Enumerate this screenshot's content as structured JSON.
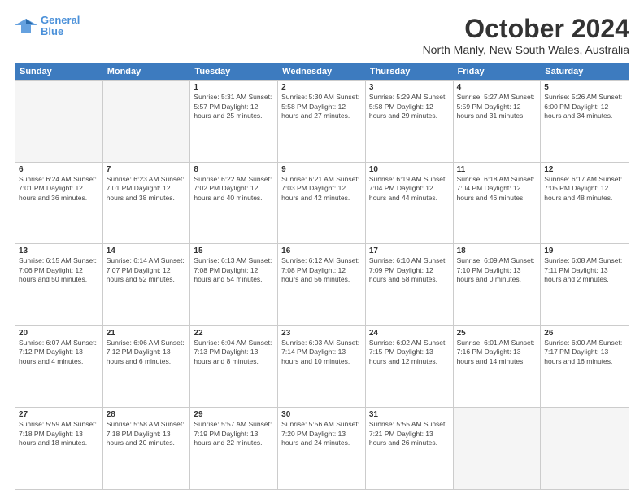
{
  "logo": {
    "line1": "General",
    "line2": "Blue"
  },
  "title": "October 2024",
  "subtitle": "North Manly, New South Wales, Australia",
  "days": [
    "Sunday",
    "Monday",
    "Tuesday",
    "Wednesday",
    "Thursday",
    "Friday",
    "Saturday"
  ],
  "weeks": [
    [
      {
        "num": "",
        "info": "",
        "empty": true
      },
      {
        "num": "",
        "info": "",
        "empty": true
      },
      {
        "num": "1",
        "info": "Sunrise: 5:31 AM\nSunset: 5:57 PM\nDaylight: 12 hours\nand 25 minutes."
      },
      {
        "num": "2",
        "info": "Sunrise: 5:30 AM\nSunset: 5:58 PM\nDaylight: 12 hours\nand 27 minutes."
      },
      {
        "num": "3",
        "info": "Sunrise: 5:29 AM\nSunset: 5:58 PM\nDaylight: 12 hours\nand 29 minutes."
      },
      {
        "num": "4",
        "info": "Sunrise: 5:27 AM\nSunset: 5:59 PM\nDaylight: 12 hours\nand 31 minutes."
      },
      {
        "num": "5",
        "info": "Sunrise: 5:26 AM\nSunset: 6:00 PM\nDaylight: 12 hours\nand 34 minutes."
      }
    ],
    [
      {
        "num": "6",
        "info": "Sunrise: 6:24 AM\nSunset: 7:01 PM\nDaylight: 12 hours\nand 36 minutes."
      },
      {
        "num": "7",
        "info": "Sunrise: 6:23 AM\nSunset: 7:01 PM\nDaylight: 12 hours\nand 38 minutes."
      },
      {
        "num": "8",
        "info": "Sunrise: 6:22 AM\nSunset: 7:02 PM\nDaylight: 12 hours\nand 40 minutes."
      },
      {
        "num": "9",
        "info": "Sunrise: 6:21 AM\nSunset: 7:03 PM\nDaylight: 12 hours\nand 42 minutes."
      },
      {
        "num": "10",
        "info": "Sunrise: 6:19 AM\nSunset: 7:04 PM\nDaylight: 12 hours\nand 44 minutes."
      },
      {
        "num": "11",
        "info": "Sunrise: 6:18 AM\nSunset: 7:04 PM\nDaylight: 12 hours\nand 46 minutes."
      },
      {
        "num": "12",
        "info": "Sunrise: 6:17 AM\nSunset: 7:05 PM\nDaylight: 12 hours\nand 48 minutes."
      }
    ],
    [
      {
        "num": "13",
        "info": "Sunrise: 6:15 AM\nSunset: 7:06 PM\nDaylight: 12 hours\nand 50 minutes."
      },
      {
        "num": "14",
        "info": "Sunrise: 6:14 AM\nSunset: 7:07 PM\nDaylight: 12 hours\nand 52 minutes."
      },
      {
        "num": "15",
        "info": "Sunrise: 6:13 AM\nSunset: 7:08 PM\nDaylight: 12 hours\nand 54 minutes."
      },
      {
        "num": "16",
        "info": "Sunrise: 6:12 AM\nSunset: 7:08 PM\nDaylight: 12 hours\nand 56 minutes."
      },
      {
        "num": "17",
        "info": "Sunrise: 6:10 AM\nSunset: 7:09 PM\nDaylight: 12 hours\nand 58 minutes."
      },
      {
        "num": "18",
        "info": "Sunrise: 6:09 AM\nSunset: 7:10 PM\nDaylight: 13 hours\nand 0 minutes."
      },
      {
        "num": "19",
        "info": "Sunrise: 6:08 AM\nSunset: 7:11 PM\nDaylight: 13 hours\nand 2 minutes."
      }
    ],
    [
      {
        "num": "20",
        "info": "Sunrise: 6:07 AM\nSunset: 7:12 PM\nDaylight: 13 hours\nand 4 minutes."
      },
      {
        "num": "21",
        "info": "Sunrise: 6:06 AM\nSunset: 7:12 PM\nDaylight: 13 hours\nand 6 minutes."
      },
      {
        "num": "22",
        "info": "Sunrise: 6:04 AM\nSunset: 7:13 PM\nDaylight: 13 hours\nand 8 minutes."
      },
      {
        "num": "23",
        "info": "Sunrise: 6:03 AM\nSunset: 7:14 PM\nDaylight: 13 hours\nand 10 minutes."
      },
      {
        "num": "24",
        "info": "Sunrise: 6:02 AM\nSunset: 7:15 PM\nDaylight: 13 hours\nand 12 minutes."
      },
      {
        "num": "25",
        "info": "Sunrise: 6:01 AM\nSunset: 7:16 PM\nDaylight: 13 hours\nand 14 minutes."
      },
      {
        "num": "26",
        "info": "Sunrise: 6:00 AM\nSunset: 7:17 PM\nDaylight: 13 hours\nand 16 minutes."
      }
    ],
    [
      {
        "num": "27",
        "info": "Sunrise: 5:59 AM\nSunset: 7:18 PM\nDaylight: 13 hours\nand 18 minutes."
      },
      {
        "num": "28",
        "info": "Sunrise: 5:58 AM\nSunset: 7:18 PM\nDaylight: 13 hours\nand 20 minutes."
      },
      {
        "num": "29",
        "info": "Sunrise: 5:57 AM\nSunset: 7:19 PM\nDaylight: 13 hours\nand 22 minutes."
      },
      {
        "num": "30",
        "info": "Sunrise: 5:56 AM\nSunset: 7:20 PM\nDaylight: 13 hours\nand 24 minutes."
      },
      {
        "num": "31",
        "info": "Sunrise: 5:55 AM\nSunset: 7:21 PM\nDaylight: 13 hours\nand 26 minutes."
      },
      {
        "num": "",
        "info": "",
        "empty": true
      },
      {
        "num": "",
        "info": "",
        "empty": true
      }
    ]
  ]
}
